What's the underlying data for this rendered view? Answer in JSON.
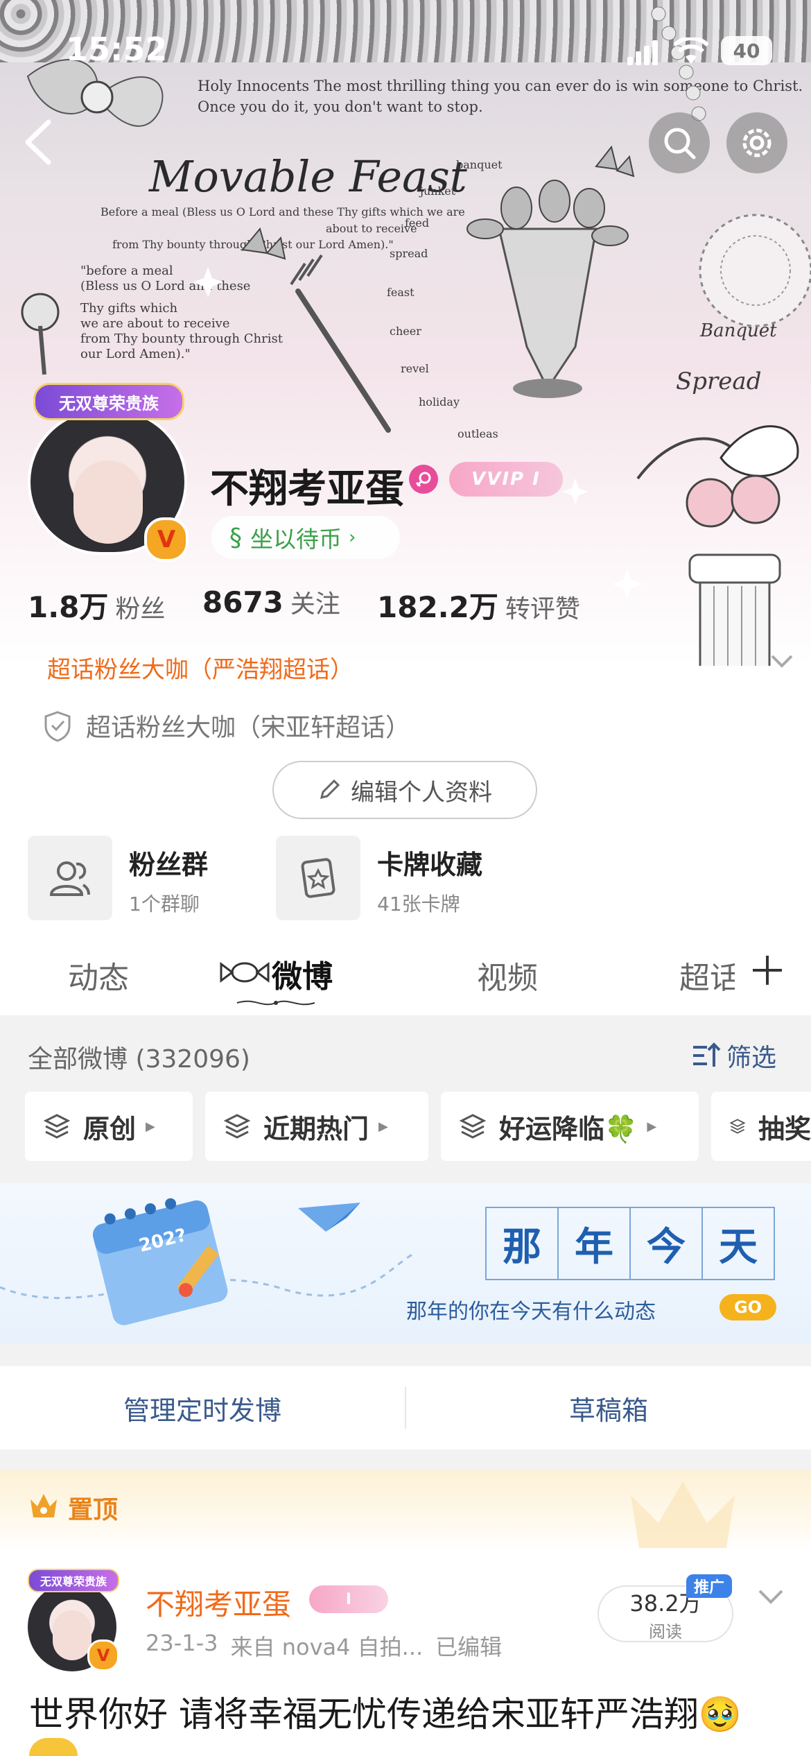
{
  "status_bar": {
    "time": "15:52",
    "battery": "40"
  },
  "cover": {
    "line1": "Holy Innocents The most thrilling thing you can ever do is win someone to Christ.",
    "line2": "Once you do it, you don't want to stop.",
    "title": "Movable Feast",
    "grace1": "Before a meal (Bless us O Lord and these Thy gifts which we are",
    "grace2": "about to receive",
    "grace3": "from Thy bounty through Christ our Lord Amen).\"",
    "grace_block": [
      "\"before a meal",
      "(Bless us O Lord and these",
      "Thy gifts which",
      "we are about to receive",
      "from Thy bounty through Christ",
      "our Lord Amen).\""
    ],
    "words": [
      "banquet",
      "junket",
      "feed",
      "spread",
      "feast",
      "cheer",
      "revel",
      "holiday",
      "outleas"
    ],
    "script1": "Banquet",
    "script2": "Spread"
  },
  "profile": {
    "badge": "无双尊荣贵族",
    "name": "不翔考亚蛋",
    "vip_label": "VVIP I",
    "coin_label": "坐以待币",
    "stats": [
      {
        "value": "1.8万",
        "label": "粉丝"
      },
      {
        "value": "8673",
        "label": "关注"
      },
      {
        "value": "182.2万",
        "label": "转评赞"
      }
    ],
    "title_orange": "超话粉丝大咖（严浩翔超话）",
    "title_gray": "超话粉丝大咖（宋亚轩超话）",
    "edit_button": "编辑个人资料"
  },
  "shortcuts": [
    {
      "title": "粉丝群",
      "sub": "1个群聊"
    },
    {
      "title": "卡牌收藏",
      "sub": "41张卡牌"
    }
  ],
  "tabs": [
    "动态",
    "微博",
    "视频",
    "超话"
  ],
  "feed": {
    "count_label": "全部微博 (332096)",
    "filter_label": "筛选",
    "pills": [
      "原创",
      "近期热门",
      "好运降临🍀",
      "抽奖"
    ],
    "banner": {
      "year": "202?",
      "chars": [
        "那",
        "年",
        "今",
        "天"
      ],
      "subtitle": "那年的你在今天有什么动态",
      "go": "GO"
    },
    "manage_schedule": "管理定时发博",
    "drafts": "草稿箱",
    "pinned_label": "置顶"
  },
  "post": {
    "badge": "无双尊荣贵族",
    "author": "不翔考亚蛋",
    "vip_label": "I",
    "meta_date": "23-1-3",
    "meta_from": "来自 nova4 自拍...",
    "meta_edited": "已编辑",
    "reads_value": "38.2万",
    "reads_label": "阅读",
    "promo": "推广",
    "text": "世界你好 请将幸福无忧传递给宋亚轩严浩翔🥹"
  },
  "colors": {
    "orange": "#f06a1a",
    "blue_link": "#3a5a8c",
    "gold": "#e8a317",
    "brand_v": "#f5a623"
  }
}
